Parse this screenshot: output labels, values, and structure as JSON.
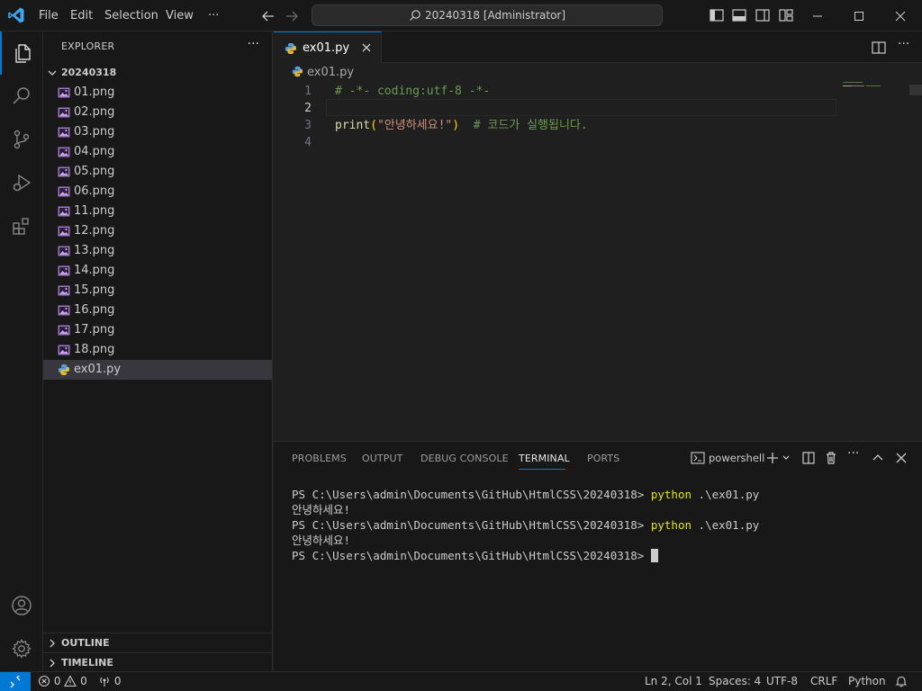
{
  "titlebar": {
    "menu": [
      "File",
      "Edit",
      "Selection",
      "View",
      "···"
    ],
    "command_center": "20240318 [Administrator]"
  },
  "sidebar": {
    "title": "EXPLORER",
    "more": "···",
    "folder": "20240318",
    "files": [
      "01.png",
      "02.png",
      "03.png",
      "04.png",
      "05.png",
      "06.png",
      "11.png",
      "12.png",
      "13.png",
      "14.png",
      "15.png",
      "16.png",
      "17.png",
      "18.png",
      "ex01.py"
    ],
    "selected_file": "ex01.py",
    "sections": [
      "OUTLINE",
      "TIMELINE"
    ]
  },
  "editor": {
    "tab_label": "ex01.py",
    "breadcrumb": "ex01.py",
    "line_numbers": [
      "1",
      "2",
      "3",
      "4"
    ],
    "line1_comment": "# -*- coding:utf-8 -*-",
    "line3_fn": "print",
    "line3_open": "(",
    "line3_str": "\"안녕하세요!\"",
    "line3_close": ")",
    "line3_comment": "# 코드가 실행됩니다."
  },
  "panel": {
    "tabs": [
      "PROBLEMS",
      "OUTPUT",
      "DEBUG CONSOLE",
      "TERMINAL",
      "PORTS"
    ],
    "active_tab": "TERMINAL",
    "shell": "powershell",
    "prompt": "PS C:\\Users\\admin\\Documents\\GitHub\\HtmlCSS\\20240318> ",
    "cmd_keyword": "python",
    "cmd_args": " .\\ex01.py",
    "output": "안녕하세요!"
  },
  "statusbar": {
    "errors": "0",
    "warnings": "0",
    "ports": "0",
    "cursor_pos": "Ln 2, Col 1",
    "spaces": "Spaces: 4",
    "encoding": "UTF-8",
    "eol": "CRLF",
    "language": "Python"
  },
  "colors": {
    "accent": "#0078d4",
    "comment": "#6a9955",
    "string": "#ce9178",
    "function": "#dcdcaa",
    "terminal_cmd": "#e5e510"
  }
}
